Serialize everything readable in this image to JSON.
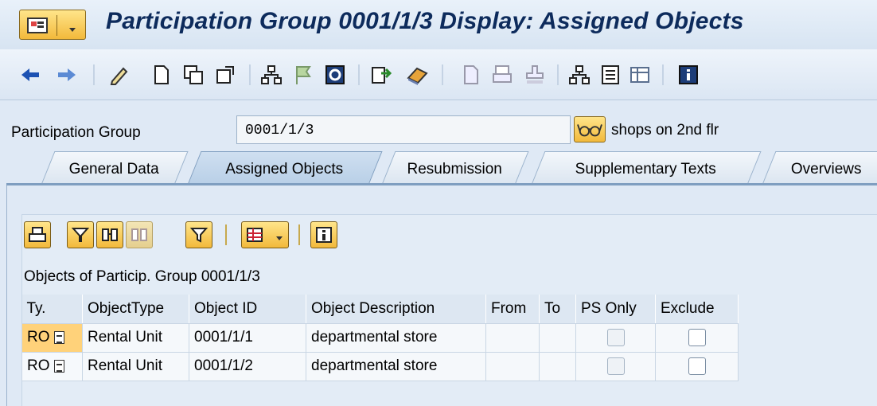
{
  "window": {
    "title": "Participation Group 0001/1/3 Display: Assigned Objects"
  },
  "toolbar": {
    "icons": [
      "back-arrow-icon",
      "forward-arrow-icon",
      "edit-icon",
      "create-icon",
      "copy-icon",
      "other-object-icon",
      "hierarchy-icon",
      "flag-icon",
      "refresh-icon",
      "display-icon",
      "delete-icon",
      "document-icon",
      "print-icon",
      "stamp-icon",
      "structure-icon",
      "list-icon",
      "table-icon",
      "info-icon"
    ]
  },
  "header": {
    "label": "Participation Group",
    "value": "0001/1/3",
    "description": "shops on 2nd flr"
  },
  "tabs": [
    {
      "label": "General Data",
      "active": false
    },
    {
      "label": "Assigned Objects",
      "active": true
    },
    {
      "label": "Resubmission",
      "active": false
    },
    {
      "label": "Supplementary Texts",
      "active": false
    },
    {
      "label": "Overviews",
      "active": false
    }
  ],
  "objects": {
    "caption": "Objects of Particip. Group 0001/1/3",
    "columns": [
      "Ty.",
      "ObjectType",
      "Object ID",
      "Object Description",
      "From",
      "To",
      "PS Only",
      "Exclude"
    ],
    "rows": [
      {
        "ty": "RO",
        "type": "Rental Unit",
        "id": "0001/1/1",
        "desc": "departmental store",
        "from": "",
        "to": "",
        "ps_only": false,
        "exclude": false
      },
      {
        "ty": "RO",
        "type": "Rental Unit",
        "id": "0001/1/2",
        "desc": "departmental store",
        "from": "",
        "to": "",
        "ps_only": false,
        "exclude": false
      }
    ]
  },
  "colors": {
    "title": "#0d2b5c",
    "button_gold": "#f2b93b",
    "selected_cell": "#ffd27a"
  }
}
